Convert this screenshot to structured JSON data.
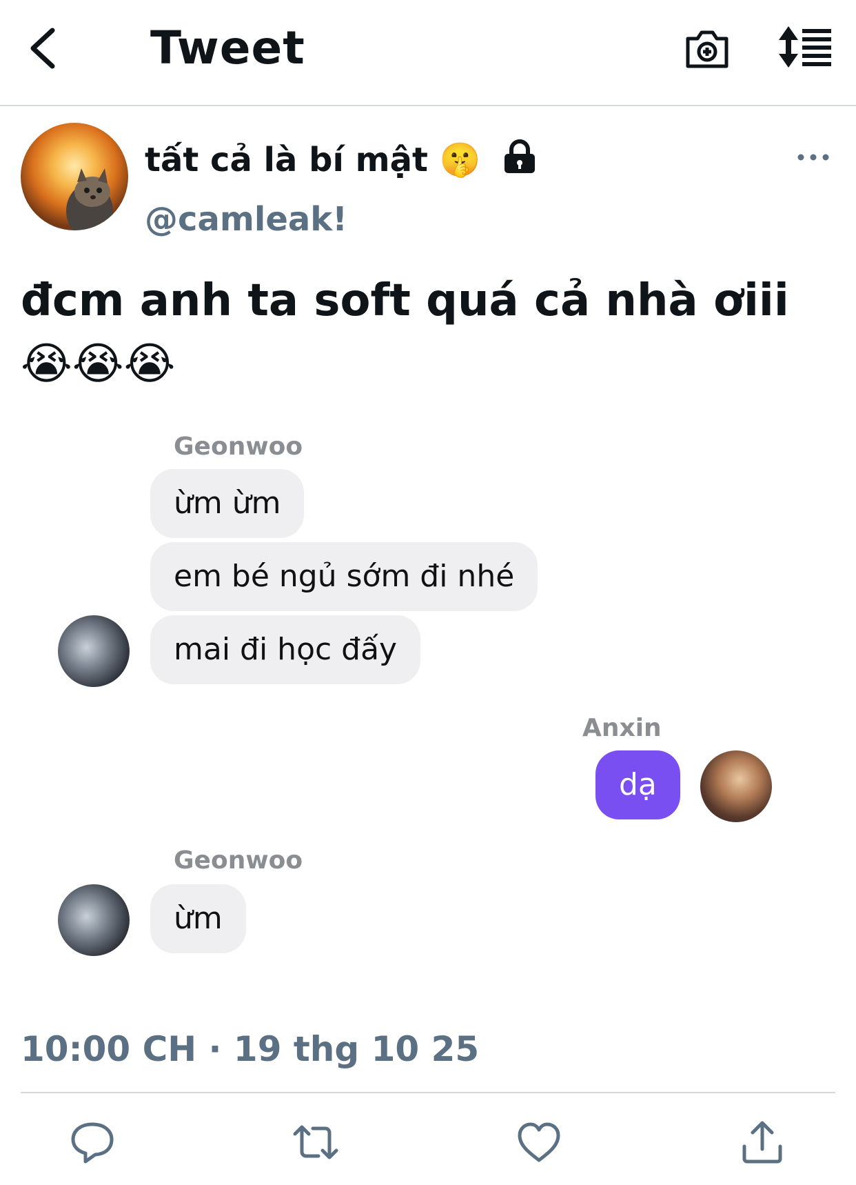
{
  "header": {
    "title": "Tweet"
  },
  "author": {
    "display_name": "tất cả là bí mật 🤫",
    "handle": "@camleak!"
  },
  "tweet": {
    "text": "đcm anh ta soft quá cả nhà ơiii😭😭😭"
  },
  "chat": {
    "group1_sender": "Geonwoo",
    "group1_msg1": "ừm ừm",
    "group1_msg2": "em bé ngủ sớm đi nhé",
    "group1_msg3": "mai đi học đấy",
    "group2_sender": "Anxin",
    "group2_msg1": "dạ",
    "group3_sender": "Geonwoo",
    "group3_msg1": "ừm",
    "outgoing_bubble_color": "#7a4ff2",
    "incoming_bubble_color": "#efeff2"
  },
  "timestamp": "10:00 CH · 19 thg 10 25",
  "icons": {
    "back": "chevron-left-icon",
    "camera": "camera-add-icon",
    "sort": "sort-list-icon",
    "more": "more-horizontal-icon",
    "lock": "lock-icon",
    "reply": "reply-icon",
    "retweet": "retweet-icon",
    "like": "heart-icon",
    "share": "share-icon"
  }
}
